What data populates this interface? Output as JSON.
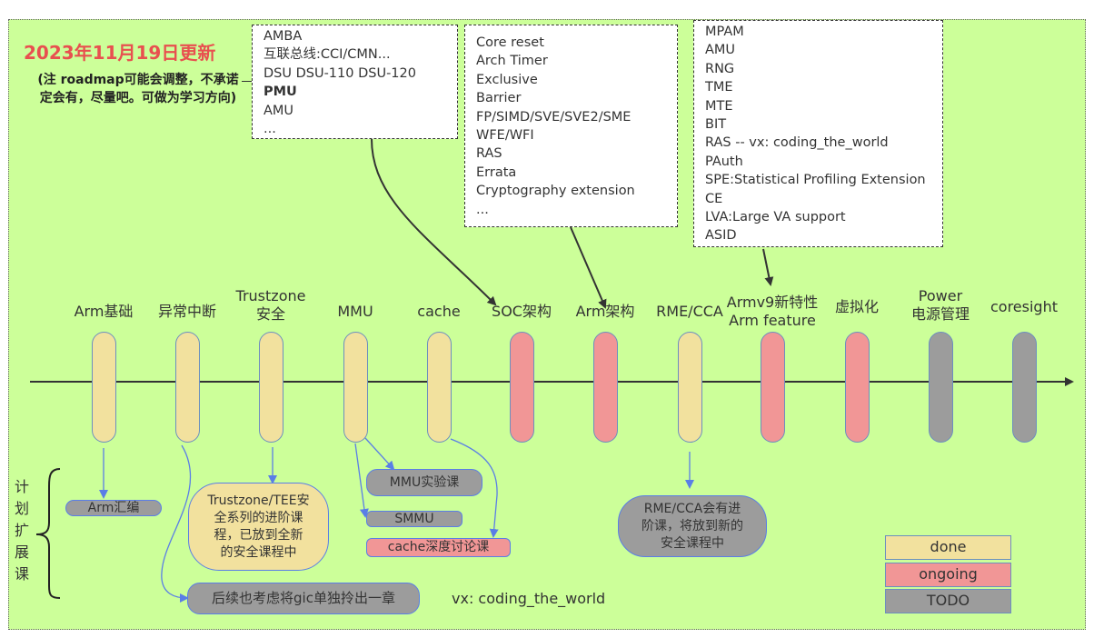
{
  "title": "2023年11月19日更新",
  "note": "(注 roadmap可能会调整，不承诺一定会有，尽量吧。可做为学习方向)",
  "note_lines": [
    "(注 roadmap可能会调整，不承诺",
    "定会有，尽量吧。可做为学习方向)"
  ],
  "detail_boxes": {
    "soc": [
      "AMBA",
      "互联总线:CCI/CMN...",
      "DSU DSU-110 DSU-120",
      "PMU",
      "AMU",
      "..."
    ],
    "arm_arch": [
      "Core reset",
      "Arch Timer",
      "Exclusive",
      "Barrier",
      "FP/SIMD/SVE/SVE2/SME",
      "WFE/WFI",
      "RAS",
      "Errata",
      "Cryptography extension",
      "..."
    ],
    "armv9": [
      "MPAM",
      "AMU",
      "RNG",
      "TME",
      "MTE",
      "BIT",
      "RAS  -- vx: coding_the_world",
      "PAuth",
      "SPE:Statistical Profiling Extension",
      "CE",
      "LVA:Large VA support",
      "ASID"
    ]
  },
  "timeline": [
    {
      "label": [
        "Arm基础"
      ],
      "status": "done"
    },
    {
      "label": [
        "异常中断"
      ],
      "status": "done"
    },
    {
      "label": [
        "Trustzone",
        "安全"
      ],
      "status": "done"
    },
    {
      "label": [
        "MMU"
      ],
      "status": "done"
    },
    {
      "label": [
        "cache"
      ],
      "status": "done"
    },
    {
      "label": [
        "SOC架构"
      ],
      "status": "ongoing"
    },
    {
      "label": [
        "Arm架构"
      ],
      "status": "ongoing"
    },
    {
      "label": [
        "RME/CCA"
      ],
      "status": "done"
    },
    {
      "label": [
        "Armv9新特性",
        "Arm feature"
      ],
      "status": "ongoing"
    },
    {
      "label": [
        "虚拟化"
      ],
      "status": "ongoing"
    },
    {
      "label": [
        "Power",
        "电源管理"
      ],
      "status": "todo"
    },
    {
      "label": [
        "coresight"
      ],
      "status": "todo"
    }
  ],
  "side_label": [
    "计",
    "划",
    "扩",
    "展",
    "课"
  ],
  "extension_courses": {
    "arm_asm": {
      "text": "Arm汇编",
      "status": "todo"
    },
    "trustzone_tee": {
      "lines": [
        "Trustzone/TEE安",
        "全系列的进阶课",
        "程，已放到全新",
        "的安全课程中"
      ],
      "status": "done"
    },
    "mmu_lab": {
      "text": "MMU实验课",
      "status": "todo"
    },
    "smmu": {
      "text": "SMMU",
      "status": "todo"
    },
    "cache_deep": {
      "text": "cache深度讨论课",
      "status": "ongoing"
    },
    "rme_cca": {
      "lines": [
        "RME/CCA会有进",
        "阶课，将放到新的",
        "安全课程中"
      ],
      "status": "todo"
    },
    "gic": {
      "text": "后续也考虑将gic单独拎出一章",
      "status": "todo"
    }
  },
  "contact": "vx: coding_the_world",
  "legend": [
    {
      "label": "done",
      "color": "#f2e19e"
    },
    {
      "label": "ongoing",
      "color": "#f19696"
    },
    {
      "label": "TODO",
      "color": "#9c9c9c"
    }
  ],
  "colors": {
    "background": "#ccff99",
    "done": "#f2e19e",
    "ongoing": "#f19696",
    "todo": "#9c9c9c",
    "title": "#e8504f",
    "connector": "#5a7ee6"
  }
}
